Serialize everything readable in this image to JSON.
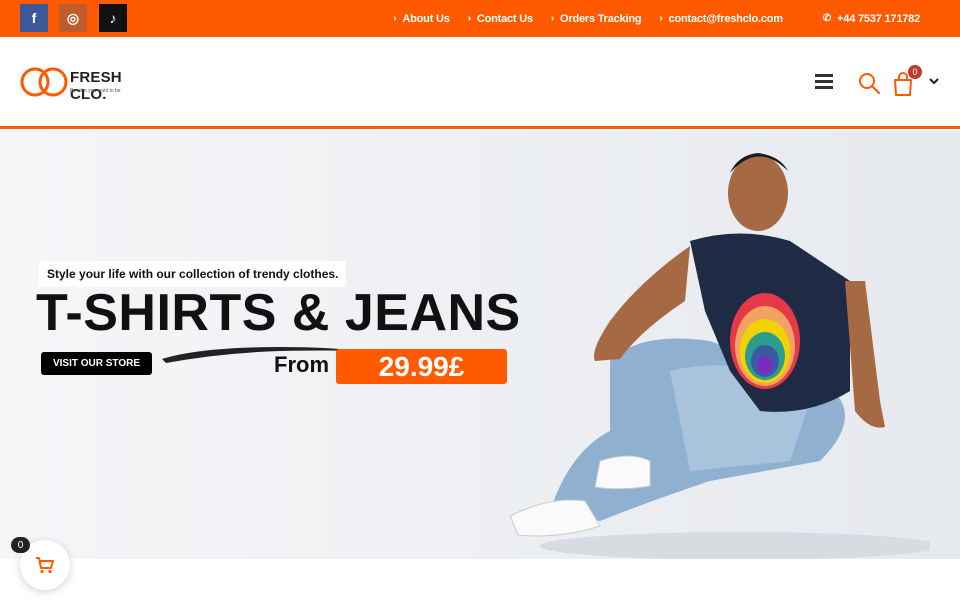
{
  "colors": {
    "accent": "#ff5a00",
    "dark": "#111111",
    "facebook": "#3b5998",
    "instagram": "#c05b2d",
    "tiktok": "#111111"
  },
  "topbar": {
    "social": [
      {
        "icon": "facebook-icon",
        "glyph": "f"
      },
      {
        "icon": "instagram-icon",
        "glyph": "◎"
      },
      {
        "icon": "tiktok-icon",
        "glyph": "♪"
      }
    ],
    "links": [
      {
        "label": "About Us"
      },
      {
        "label": "Contact Us"
      },
      {
        "label": "Orders Tracking"
      },
      {
        "label": "contact@freshclo.com"
      }
    ],
    "phone": "+44 7537 171782"
  },
  "header": {
    "logo_name": "FRESH CLO.",
    "logo_tagline": "Be who you want to be",
    "cart_count": "0"
  },
  "hero": {
    "tagline": "Style your life with our collection of trendy clothes.",
    "headline": "T-SHIRTS & JEANS",
    "cta": "VISIT OUR STORE",
    "from_label": "From",
    "price": "29.99£"
  },
  "floating_cart": {
    "count": "0"
  }
}
